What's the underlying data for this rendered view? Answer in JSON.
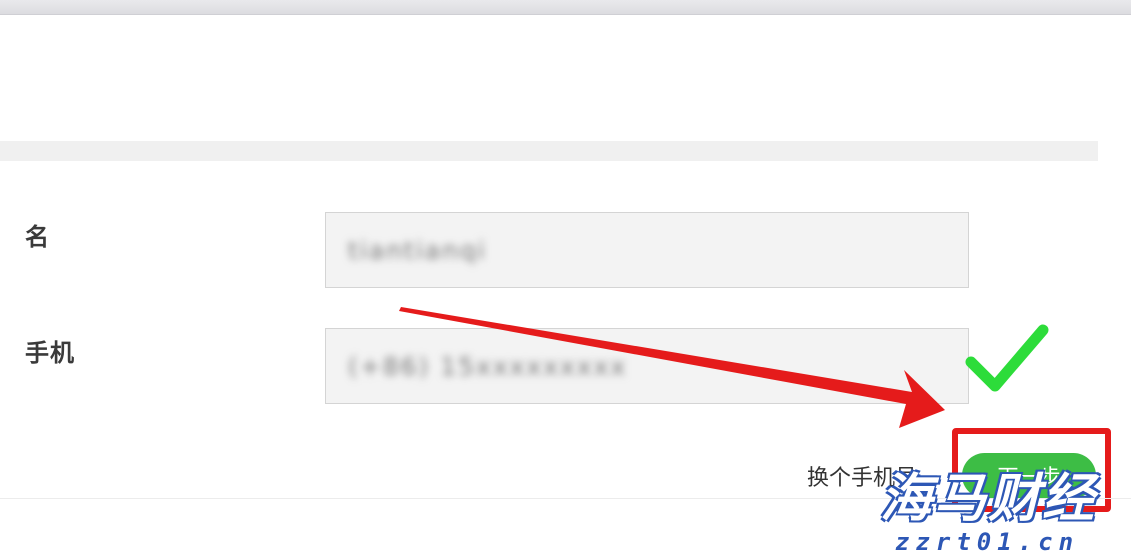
{
  "form": {
    "name_label": "名",
    "name_value": "tiantianqi",
    "phone_label": "手机",
    "phone_value": "(+86) 15xxxxxxxxx"
  },
  "actions": {
    "change_phone": "换个手机号",
    "next_button": "下一步"
  },
  "icons": {
    "verified": "check-icon",
    "annotation": "red-arrow-icon"
  },
  "watermark": {
    "brand": "海马财经",
    "url": "zzrt01.cn"
  },
  "colors": {
    "button_green": "#3dbd45",
    "check_green": "#2ddc3a",
    "annotation_red": "#e51b1b",
    "watermark_blue": "#2d57b5"
  }
}
